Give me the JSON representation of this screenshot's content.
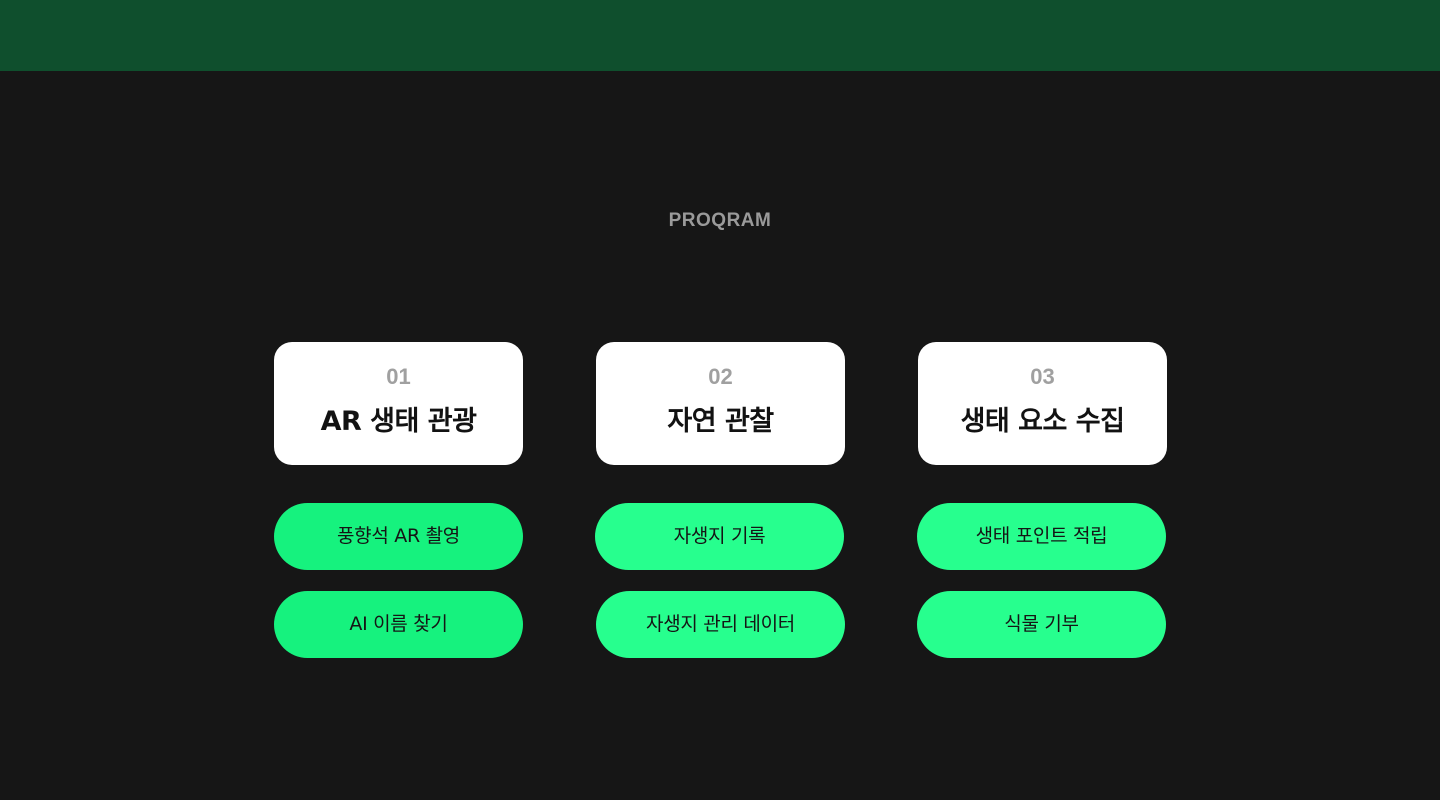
{
  "section": {
    "label": "PROQRAM"
  },
  "programs": [
    {
      "number": "01",
      "title": "AR 생태 관광",
      "items": [
        "풍향석 AR 촬영",
        "AI 이름 찾기"
      ]
    },
    {
      "number": "02",
      "title": "자연 관찰",
      "items": [
        "자생지 기록",
        "자생지 관리 데이터"
      ]
    },
    {
      "number": "03",
      "title": "생태 요소 수집",
      "items": [
        "생태 포인트 적립",
        "식물 기부"
      ]
    }
  ],
  "colors": {
    "top_band": "#0f4f2d",
    "background": "#161616",
    "pill_green": "#27ff8e",
    "card": "#ffffff"
  }
}
